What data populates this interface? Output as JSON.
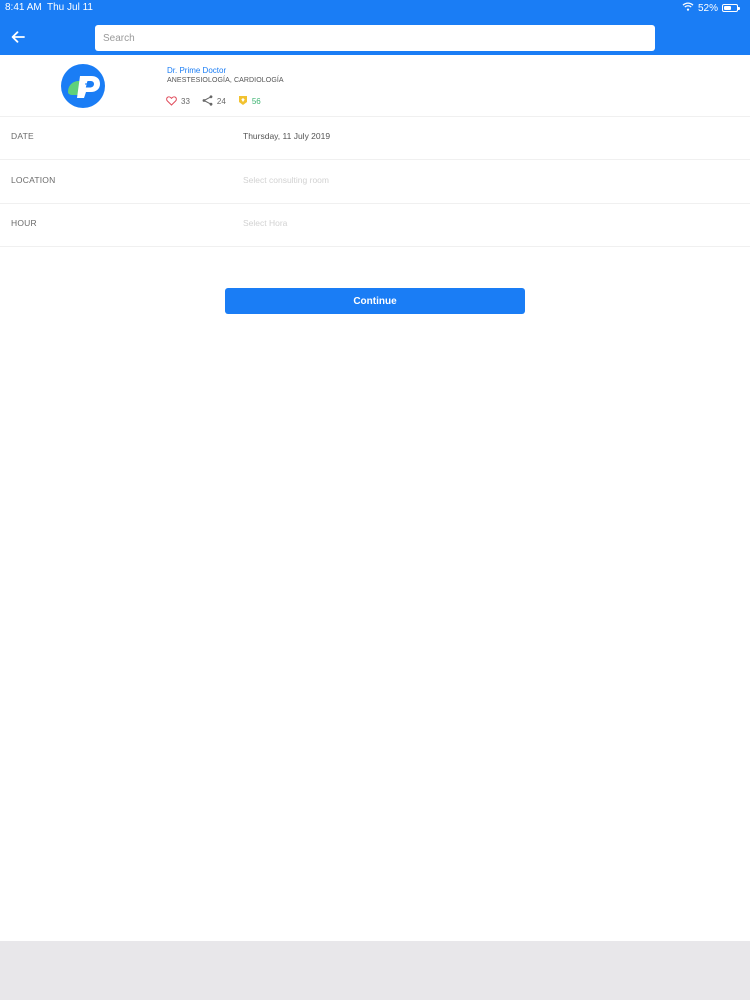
{
  "status_bar": {
    "time": "8:41 AM",
    "date": "Thu Jul 11",
    "battery": "52%",
    "battery_level": 0.52
  },
  "header": {
    "search_placeholder": "Search",
    "accent_color": "#1a7df5"
  },
  "doctor": {
    "name": "Dr. Prime Doctor",
    "specialties": "ANESTESIOLOGÍA, CARDIOLOGÍA",
    "likes": "33",
    "shares": "24",
    "badges": "56"
  },
  "form": {
    "rows": [
      {
        "label": "DATE",
        "value": "Thursday, 11 July 2019"
      },
      {
        "label": "LOCATION",
        "value": "Select consulting room"
      },
      {
        "label": "HOUR",
        "value": "Select Hora"
      }
    ],
    "continue_label": "Continue"
  },
  "icons": [
    "back-arrow-icon",
    "wifi-icon",
    "battery-icon",
    "heart-icon",
    "share-icon",
    "badge-icon"
  ]
}
